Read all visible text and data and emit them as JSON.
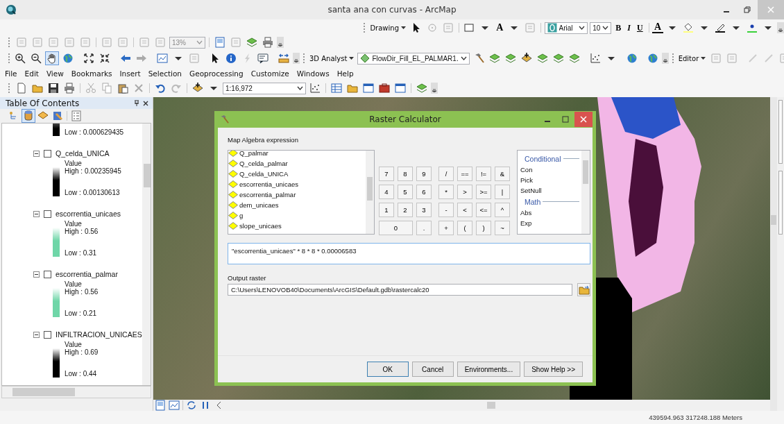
{
  "window": {
    "title": "santa ana con curvas - ArcMap"
  },
  "drawing_toolbar": {
    "menu": "Drawing",
    "font": "Arial",
    "font_size": "10",
    "bold": "B",
    "italic": "I",
    "underline": "U",
    "text_color": "A",
    "text_tool": "A"
  },
  "zoom_toolbar": {
    "zoom": "13%"
  },
  "tools_toolbar": {
    "analyst_menu": "3D Analyst",
    "layer": "FlowDir_Fill_EL_PALMAR1.",
    "editor_menu": "Editor"
  },
  "menu": [
    "File",
    "Edit",
    "View",
    "Bookmarks",
    "Insert",
    "Selection",
    "Geoprocessing",
    "Customize",
    "Windows",
    "Help"
  ],
  "standard_toolbar": {
    "scale": "1:16,972"
  },
  "toc": {
    "title": "Table Of Contents",
    "top_low": "Low : 0.000629435",
    "layers": [
      {
        "name": "Q_celda_UNICA",
        "expanded": true,
        "checked": false,
        "value_label": "Value",
        "high": "High : 0.00235945",
        "low": "Low : 0.00130613",
        "color": "#000000"
      },
      {
        "name": "escorrentia_unicaes",
        "expanded": true,
        "checked": false,
        "value_label": "Value",
        "high": "High : 0.56",
        "low": "Low : 0.31",
        "color": "#6fd6a8"
      },
      {
        "name": "escorrentia_palmar",
        "expanded": true,
        "checked": false,
        "value_label": "Value",
        "high": "High : 0.56",
        "low": "Low : 0.21",
        "color": "#6fd6a8"
      },
      {
        "name": "INFILTRACION_UNICAES",
        "expanded": true,
        "checked": false,
        "value_label": "Value",
        "high": "High : 0.69",
        "low": "Low : 0.44",
        "color": "#000000"
      }
    ]
  },
  "dialog": {
    "title": "Raster Calculator",
    "expression_label": "Map Algebra expression",
    "layers": [
      "Q_palmar",
      "Q_celda_palmar",
      "Q_celda_UNICA",
      "escorrentia_unicaes",
      "escorrentia_palmar",
      "dem_unicaes",
      "g",
      "slope_unicaes"
    ],
    "digits": [
      "7",
      "8",
      "9",
      "4",
      "5",
      "6",
      "1",
      "2",
      "3",
      "0",
      "."
    ],
    "operators": [
      "/",
      "==",
      "!=",
      "&",
      "*",
      ">",
      ">=",
      "|",
      "-",
      "<",
      "<=",
      "^",
      "+",
      "(",
      ")",
      "~"
    ],
    "tools": [
      {
        "kind": "header",
        "label": "Conditional"
      },
      {
        "kind": "item",
        "label": "Con"
      },
      {
        "kind": "item",
        "label": "Pick"
      },
      {
        "kind": "item",
        "label": "SetNull"
      },
      {
        "kind": "header",
        "label": "Math"
      },
      {
        "kind": "item",
        "label": "Abs"
      },
      {
        "kind": "item",
        "label": "Exp"
      }
    ],
    "expression": "\"escorrentia_unicaes\" * 8 * 8 * 0.00006583",
    "output_label": "Output raster",
    "output": "C:\\Users\\LENOVOB40\\Documents\\ArcGIS\\Default.gdb\\rastercalc20",
    "buttons": [
      {
        "label": "OK",
        "default": true
      },
      {
        "label": "Cancel",
        "default": false
      },
      {
        "label": "Environments...",
        "default": false
      },
      {
        "label": "Show Help >>",
        "default": false
      }
    ]
  },
  "status_bar": {
    "coordinates": "439594.963 317248.188 Meters"
  }
}
